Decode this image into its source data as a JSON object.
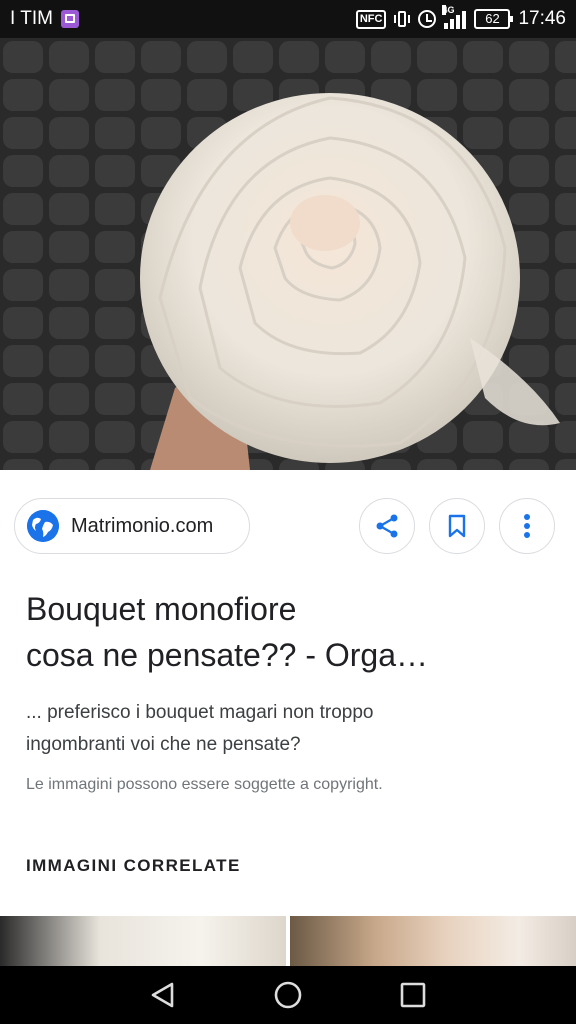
{
  "status_bar": {
    "carrier": "I TIM",
    "nfc_label": "NFC",
    "network": "4G",
    "battery": "62",
    "time": "17:46"
  },
  "hero_image": {
    "icon": "white-rose-bouquet-image"
  },
  "source": {
    "label": "Matrimonio.com",
    "icon": "globe-icon",
    "accent": "#1a73e8"
  },
  "actions": {
    "share_icon": "share-icon",
    "save_icon": "bookmark-icon",
    "more_icon": "more-vertical-icon"
  },
  "result": {
    "title_line1": "Bouquet monofiore",
    "title_line2": "cosa ne pensate?? - Orga…",
    "description_line1": "... preferisco i bouquet magari non troppo",
    "description_line2": "ingombranti voi che ne pensate?",
    "copyright": "Le immagini possono essere soggette a copyright."
  },
  "related": {
    "heading": "IMMAGINI CORRELATE"
  },
  "nav": {
    "back_icon": "back-triangle-icon",
    "home_icon": "home-circle-icon",
    "recents_icon": "recents-square-icon"
  }
}
